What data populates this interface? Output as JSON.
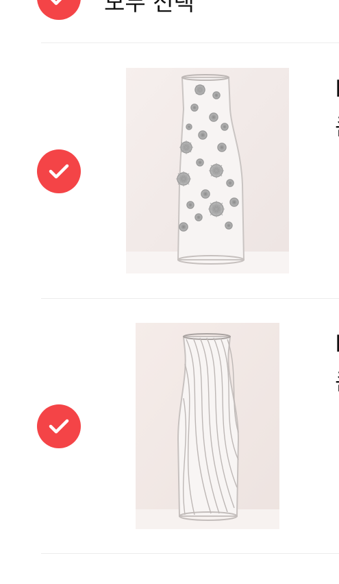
{
  "select_all": {
    "label": "모두 선택",
    "checked": true,
    "check_icon": "check-icon"
  },
  "cart": {
    "items": [
      {
        "checked": true,
        "image_icon": "glass-chimney-snowflake-image",
        "name_line1": "L",
        "name_line2": "큰"
      },
      {
        "checked": true,
        "image_icon": "glass-chimney-swirl-image",
        "name_line1": "L",
        "name_line2": "큰"
      }
    ]
  },
  "colors": {
    "accent_red": "#f44447",
    "divider": "#ececec",
    "image_background": "#f3ebe8"
  }
}
